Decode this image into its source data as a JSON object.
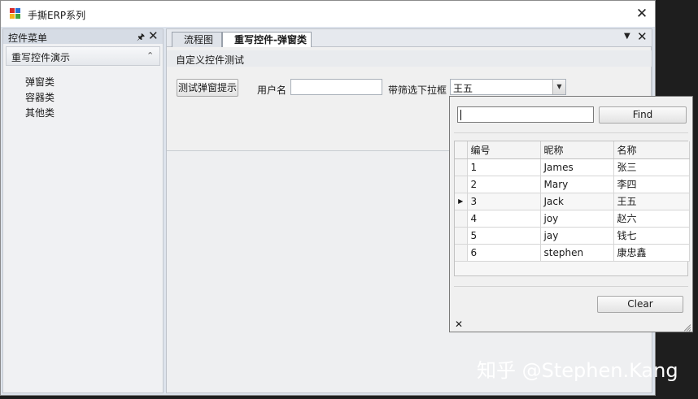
{
  "window": {
    "title": "手撕ERP系列",
    "close_glyph": "✕"
  },
  "sidebar": {
    "title": "控件菜单",
    "pin_glyph": "🖈",
    "close_glyph": "✕",
    "group": {
      "label": "重写控件演示",
      "chevron_glyph": "⌃"
    },
    "items": [
      {
        "label": "弹窗类"
      },
      {
        "label": "容器类"
      },
      {
        "label": "其他类"
      }
    ]
  },
  "tabs": [
    {
      "label": "流程图",
      "active": false
    },
    {
      "label": "重写控件-弹窗类",
      "active": true
    }
  ],
  "tab_controls": {
    "dropdown_glyph": "▼",
    "close_glyph": "✕"
  },
  "page": {
    "group_label": "自定义控件测试",
    "test_button_label": "测试弹窗提示",
    "username_label": "用户名",
    "username_value": "",
    "filter_label": "带筛选下拉框",
    "combo_value": "王五",
    "combo_arrow_glyph": "▼"
  },
  "popup": {
    "search_value": "",
    "find_label": "Find",
    "clear_label": "Clear",
    "close_glyph": "✕",
    "current_row_glyph": "▶",
    "columns": [
      "编号",
      "昵称",
      "名称"
    ],
    "rows": [
      {
        "id": "1",
        "nickname": "James",
        "name": "张三"
      },
      {
        "id": "2",
        "nickname": "Mary",
        "name": "李四"
      },
      {
        "id": "3",
        "nickname": "Jack",
        "name": "王五"
      },
      {
        "id": "4",
        "nickname": "joy",
        "name": "赵六"
      },
      {
        "id": "5",
        "nickname": "jay",
        "name": "钱七"
      },
      {
        "id": "6",
        "nickname": "stephen",
        "name": "康忠鑫"
      }
    ],
    "current_row_index": 2
  },
  "watermark": "知乎 @Stephen.Kang",
  "colors": {
    "app_icon": [
      "#d62a2a",
      "#2a6fd6",
      "#f2b31d",
      "#3fa33f"
    ]
  }
}
